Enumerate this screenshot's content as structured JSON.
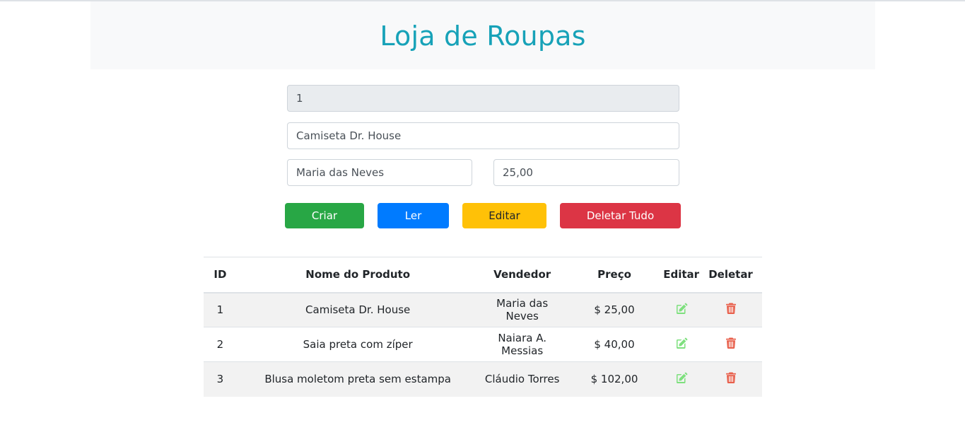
{
  "header": {
    "title": "Loja de Roupas"
  },
  "form": {
    "id_value": "1",
    "name_value": "Camiseta Dr. House",
    "seller_value": "Maria das Neves",
    "price_value": "25,00"
  },
  "buttons": {
    "create": "Criar",
    "read": "Ler",
    "edit": "Editar",
    "delete_all": "Deletar Tudo"
  },
  "table": {
    "columns": [
      "ID",
      "Nome do Produto",
      "Vendedor",
      "Preço",
      "Editar",
      "Deletar"
    ],
    "rows": [
      {
        "id": "1",
        "name": "Camiseta Dr. House",
        "seller": "Maria das Neves",
        "price": "$ 25,00"
      },
      {
        "id": "2",
        "name": "Saia preta com zíper",
        "seller": "Naiara A. Messias",
        "price": "$ 40,00"
      },
      {
        "id": "3",
        "name": "Blusa moletom preta sem estampa",
        "seller": "Cláudio Torres",
        "price": "$ 102,00"
      }
    ],
    "edit_icon": "edit-icon",
    "delete_icon": "trash-icon"
  },
  "colors": {
    "title": "#17a2b8",
    "create": "#28a745",
    "read": "#007bff",
    "edit": "#ffc107",
    "delete_all": "#dc3545",
    "edit_icon": "#7ee07e",
    "delete_icon": "#e8604c"
  }
}
